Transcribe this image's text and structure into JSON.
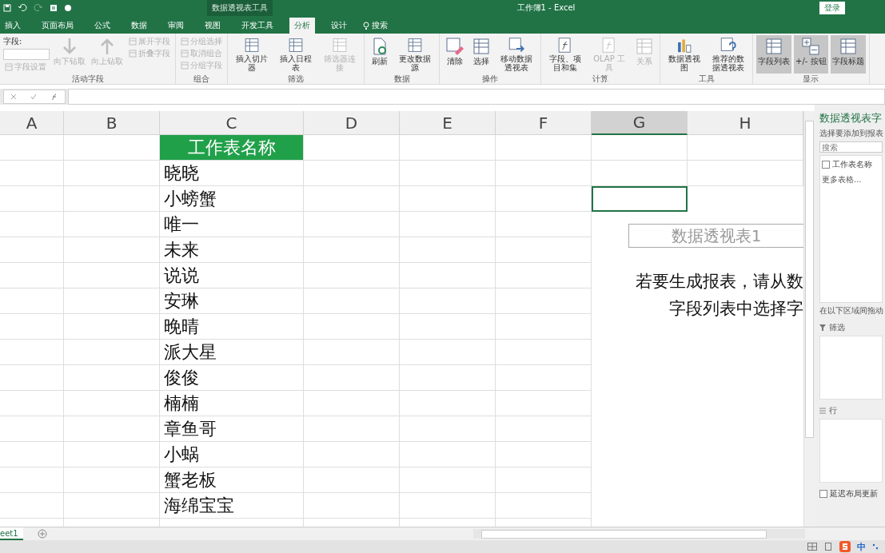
{
  "title_bar": {
    "context_label": "数据透视表工具",
    "title": "工作簿1 - Excel",
    "sign_in": "登录"
  },
  "tabs": [
    {
      "label": "插入",
      "selected": false
    },
    {
      "label": "页面布局",
      "selected": false
    },
    {
      "label": "公式",
      "selected": false
    },
    {
      "label": "数据",
      "selected": false
    },
    {
      "label": "审阅",
      "selected": false
    },
    {
      "label": "视图",
      "selected": false
    },
    {
      "label": "开发工具",
      "selected": false
    },
    {
      "label": "分析",
      "selected": true
    },
    {
      "label": "设计",
      "selected": false
    }
  ],
  "search": {
    "label": "搜索"
  },
  "ribbon": {
    "groups": [
      {
        "label": "活动字段",
        "items": [
          {
            "kind": "stack",
            "entries": [
              {
                "kind": "field",
                "label": "字段:"
              },
              {
                "kind": "small",
                "label": "字段设置",
                "disabled": true
              }
            ]
          },
          {
            "kind": "large",
            "label": "向下钻取",
            "disabled": true,
            "selected": false
          },
          {
            "kind": "large",
            "label": "向上钻取",
            "disabled": true,
            "selected": false
          },
          {
            "kind": "stack",
            "entries": [
              {
                "kind": "small",
                "label": "展开字段",
                "disabled": true
              },
              {
                "kind": "small",
                "label": "折叠字段",
                "disabled": true
              }
            ]
          }
        ]
      },
      {
        "label": "组合",
        "items": [
          {
            "kind": "stack",
            "entries": [
              {
                "kind": "small",
                "label": "分组选择",
                "disabled": true
              },
              {
                "kind": "small",
                "label": "取消组合",
                "disabled": true
              },
              {
                "kind": "small",
                "label": "分组字段",
                "disabled": true
              }
            ]
          }
        ]
      },
      {
        "label": "筛选",
        "items": [
          {
            "kind": "large",
            "label": "插入切片器",
            "disabled": false,
            "selected": false
          },
          {
            "kind": "large",
            "label": "插入日程表",
            "disabled": false,
            "selected": false
          },
          {
            "kind": "large",
            "label": "筛选器连接",
            "disabled": true,
            "selected": false
          }
        ]
      },
      {
        "label": "数据",
        "items": [
          {
            "kind": "large",
            "label": "刷新",
            "disabled": false,
            "selected": false
          },
          {
            "kind": "large",
            "label": "更改数据源",
            "disabled": false,
            "selected": false
          }
        ]
      },
      {
        "label": "操作",
        "items": [
          {
            "kind": "large",
            "label": "清除",
            "disabled": false,
            "selected": false
          },
          {
            "kind": "large",
            "label": "选择",
            "disabled": false,
            "selected": false
          },
          {
            "kind": "large",
            "label": "移动数据透视表",
            "disabled": false,
            "selected": false
          }
        ]
      },
      {
        "label": "计算",
        "items": [
          {
            "kind": "large",
            "label": "字段、项目和集",
            "disabled": false,
            "selected": false
          },
          {
            "kind": "large",
            "label": "OLAP 工具",
            "disabled": true,
            "selected": false
          },
          {
            "kind": "large",
            "label": "关系",
            "disabled": true,
            "selected": false
          }
        ]
      },
      {
        "label": "工具",
        "items": [
          {
            "kind": "large",
            "label": "数据透视图",
            "disabled": false,
            "selected": false
          },
          {
            "kind": "large",
            "label": "推荐的数据透视表",
            "disabled": false,
            "selected": false
          }
        ]
      },
      {
        "label": "显示",
        "items": [
          {
            "kind": "large",
            "label": "字段列表",
            "disabled": false,
            "selected": true
          },
          {
            "kind": "large",
            "label": "+/- 按钮",
            "disabled": false,
            "selected": true
          },
          {
            "kind": "large",
            "label": "字段标题",
            "disabled": false,
            "selected": true
          }
        ]
      }
    ]
  },
  "sheet": {
    "columns": [
      {
        "label": "A",
        "selected": false
      },
      {
        "label": "B",
        "selected": false
      },
      {
        "label": "C",
        "selected": false
      },
      {
        "label": "D",
        "selected": false
      },
      {
        "label": "E",
        "selected": false
      },
      {
        "label": "F",
        "selected": false
      },
      {
        "label": "G",
        "selected": true
      },
      {
        "label": "H",
        "selected": false
      }
    ],
    "column_c": [
      {
        "kind": "header",
        "text": "工作表名称"
      },
      {
        "kind": "value",
        "text": "晓晓"
      },
      {
        "kind": "value",
        "text": "小螃蟹"
      },
      {
        "kind": "value",
        "text": "唯一"
      },
      {
        "kind": "value",
        "text": "未来"
      },
      {
        "kind": "value",
        "text": "说说"
      },
      {
        "kind": "value",
        "text": "安琳"
      },
      {
        "kind": "value",
        "text": "晚晴"
      },
      {
        "kind": "value",
        "text": "派大星"
      },
      {
        "kind": "value",
        "text": "俊俊"
      },
      {
        "kind": "value",
        "text": "楠楠"
      },
      {
        "kind": "value",
        "text": "章鱼哥"
      },
      {
        "kind": "value",
        "text": "小蜗"
      },
      {
        "kind": "value",
        "text": "蟹老板"
      },
      {
        "kind": "value",
        "text": "海绵宝宝"
      }
    ],
    "sheet_tab": "eet1"
  },
  "pivot": {
    "title": "数据透视表1",
    "message_lines": [
      "若要生成报表，请从数",
      "字段列表中选择字"
    ]
  },
  "field_pane": {
    "title": "数据透视表字",
    "subtitle": "选择要添加到报表",
    "search_placeholder": "搜索",
    "fields": [
      {
        "label": "工作表名称",
        "checked": false
      }
    ],
    "more_tables": "更多表格...",
    "drag_hint": "在以下区域间拖动",
    "areas": [
      {
        "kind": "filter",
        "label": "筛选"
      },
      {
        "kind": "rows",
        "label": "行"
      }
    ],
    "defer": {
      "label": "延迟布局更新",
      "checked": false
    }
  },
  "status_bar": {
    "ime_label": "中"
  }
}
